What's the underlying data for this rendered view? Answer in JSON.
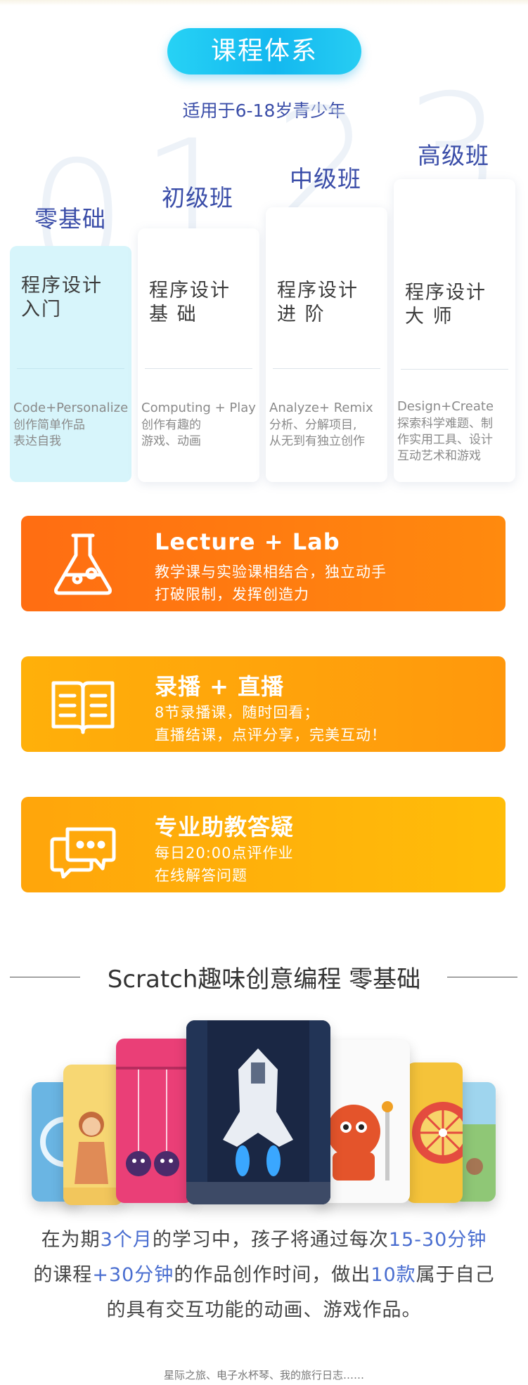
{
  "header": {
    "title": "课程体系",
    "subtitle": "适用于6-18岁青少年"
  },
  "levels": [
    {
      "number": "0",
      "name": "零基础",
      "title": "程序设计\n入门",
      "en": "Code+Personalize",
      "cn": "创作简单作品\n表达自我"
    },
    {
      "number": "1",
      "name": "初级班",
      "title": "程序设计\n基 础",
      "en": "Computing + Play",
      "cn": "创作有趣的\n游戏、动画"
    },
    {
      "number": "2",
      "name": "中级班",
      "title": "程序设计\n进 阶",
      "en": "Analyze+ Remix",
      "cn": "分析、分解项目,\n从无到有独立创作"
    },
    {
      "number": "3",
      "name": "高级班",
      "title": "程序设计\n大 师",
      "en": "Design+Create",
      "cn": "探索科学难题、制\n作实用工具、设计\n互动艺术和游戏"
    }
  ],
  "features": [
    {
      "icon": "flask-icon",
      "title": "Lecture + Lab",
      "line1": "教学课与实验课相结合，独立动手",
      "line2": "打破限制，发挥创造力"
    },
    {
      "icon": "book-icon",
      "title": "录播 + 直播",
      "line1": "8节录播课，随时回看；",
      "line2": "直播结课，点评分享，完美互动！"
    },
    {
      "icon": "chat-bubbles-icon",
      "title": "专业助教答疑",
      "line1": "每日20:00点评作业",
      "line2": "在线解答问题"
    }
  ],
  "scratch": {
    "title": "Scratch趣味创意编程 零基础",
    "desc": {
      "l1_a": "在为期",
      "l1_b": "3个月",
      "l1_c": "的学习中，孩子将通过每次",
      "l1_d": "15-30分钟",
      "l2_a": "的课程",
      "l2_b": "+30分钟",
      "l2_c": "的作品创作时间，做出",
      "l2_d": "10款",
      "l2_e": "属于自己",
      "l3": "的具有交互功能的动画、游戏作品。"
    },
    "footnote": "星际之旅、电子水杯琴、我的旅行日志……"
  },
  "colors": {
    "accent_blue": "#3a4da8",
    "highlight_blue": "#4a6ed0",
    "pill_cyan": "#13b8ef",
    "banner_orange": "#ff7a10",
    "banner_yellow": "#ffb00a",
    "teal_card": "#d7f5fb"
  }
}
